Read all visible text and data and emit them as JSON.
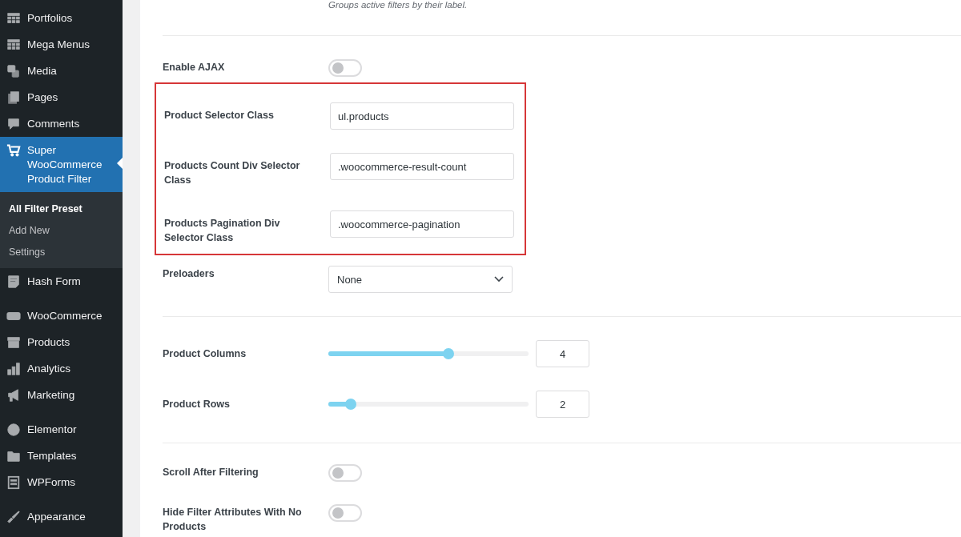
{
  "sidebar": {
    "groups": [
      {
        "items": [
          {
            "label": "Portfolios",
            "kind": "grid",
            "selected": false
          },
          {
            "label": "Mega Menus",
            "kind": "grid",
            "selected": false
          },
          {
            "label": "Media",
            "kind": "media",
            "selected": false
          },
          {
            "label": "Pages",
            "kind": "pages",
            "selected": false
          },
          {
            "label": "Comments",
            "kind": "comment",
            "selected": false
          },
          {
            "label": "Super WooCommerce Product Filter",
            "kind": "cart",
            "selected": true,
            "submenu": [
              {
                "label": "All Filter Preset",
                "selected": true
              },
              {
                "label": "Add New",
                "selected": false
              },
              {
                "label": "Settings",
                "selected": false
              }
            ]
          },
          {
            "label": "Hash Form",
            "kind": "form",
            "selected": false
          }
        ]
      },
      {
        "items": [
          {
            "label": "WooCommerce",
            "kind": "woo",
            "selected": false
          },
          {
            "label": "Products",
            "kind": "box",
            "selected": false
          },
          {
            "label": "Analytics",
            "kind": "bars",
            "selected": false
          },
          {
            "label": "Marketing",
            "kind": "megaphone",
            "selected": false
          }
        ]
      },
      {
        "items": [
          {
            "label": "Elementor",
            "kind": "elementor",
            "selected": false
          },
          {
            "label": "Templates",
            "kind": "folder",
            "selected": false
          },
          {
            "label": "WPForms",
            "kind": "wpforms",
            "selected": false
          }
        ]
      },
      {
        "items": [
          {
            "label": "Appearance",
            "kind": "brush",
            "selected": false
          }
        ]
      }
    ]
  },
  "top_hint": "Groups active filters by their label.",
  "sections": [
    {
      "rows": [
        {
          "kind": "toggle",
          "label": "Enable AJAX",
          "on": false
        },
        {
          "kind": "group",
          "highlighted": true,
          "rows": [
            {
              "kind": "text",
              "label": "Product Selector Class",
              "value": "ul.products"
            },
            {
              "kind": "text",
              "label": "Products Count Div Selector Class",
              "value": ".woocommerce-result-count"
            },
            {
              "kind": "text",
              "label": "Products Pagination Div Selector Class",
              "value": ".woocommerce-pagination"
            }
          ]
        },
        {
          "kind": "select",
          "label": "Preloaders",
          "value": "None"
        }
      ]
    },
    {
      "rows": [
        {
          "kind": "slider",
          "label": "Product Columns",
          "level": 0.6,
          "value": "4"
        },
        {
          "kind": "slider",
          "label": "Product Rows",
          "level": 0.11,
          "value": "2"
        }
      ]
    },
    {
      "rows": [
        {
          "kind": "toggle",
          "label": "Scroll After Filtering",
          "on": false
        },
        {
          "kind": "toggle",
          "label": "Hide Filter Attributes With No Products",
          "on": false
        }
      ]
    }
  ]
}
